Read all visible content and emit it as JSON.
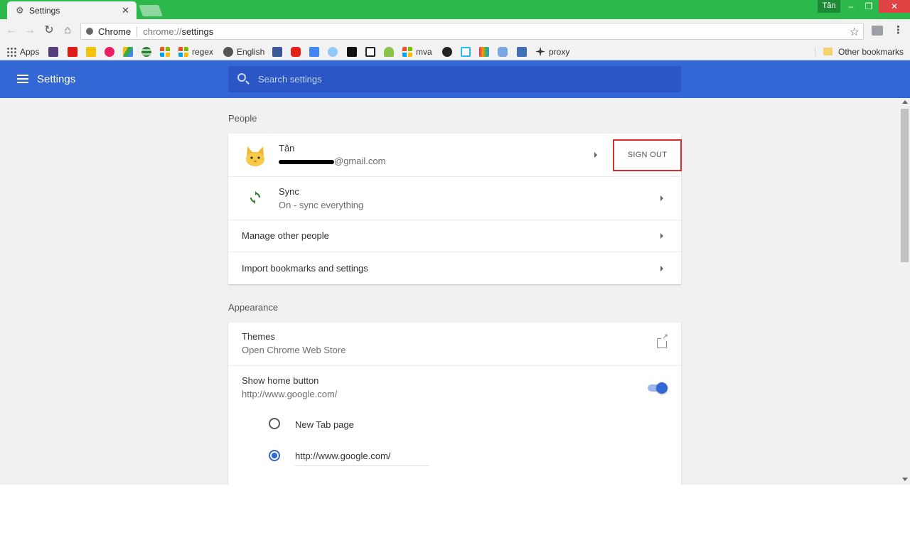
{
  "window": {
    "tab_title": "Settings",
    "profile_name": "Tân",
    "minimize": "–",
    "restore": "❐",
    "close": "✕"
  },
  "toolbar": {
    "site_label": "Chrome",
    "url_scheme": "chrome://",
    "url_path": "settings"
  },
  "bookmarks": {
    "apps": "Apps",
    "regex": "regex",
    "english": "English",
    "mva": "mva",
    "proxy": "proxy",
    "other": "Other bookmarks"
  },
  "header": {
    "title": "Settings",
    "search_placeholder": "Search settings"
  },
  "people": {
    "section_title": "People",
    "user_name": "Tân",
    "email_suffix": "@gmail.com",
    "sign_out": "SIGN OUT",
    "sync_label": "Sync",
    "sync_status": "On - sync everything",
    "manage_people": "Manage other people",
    "import_bookmarks": "Import bookmarks and settings"
  },
  "appearance": {
    "section_title": "Appearance",
    "themes_label": "Themes",
    "themes_sub": "Open Chrome Web Store",
    "home_button_label": "Show home button",
    "home_button_url": "http://www.google.com/",
    "home_button_enabled": true,
    "option_new_tab": "New Tab page",
    "option_custom_url": "http://www.google.com/",
    "selected_option": "custom_url"
  },
  "colors": {
    "titlebar": "#2db84b",
    "header": "#3367d6",
    "search": "#2a56c6",
    "highlight": "#d32f2f"
  }
}
